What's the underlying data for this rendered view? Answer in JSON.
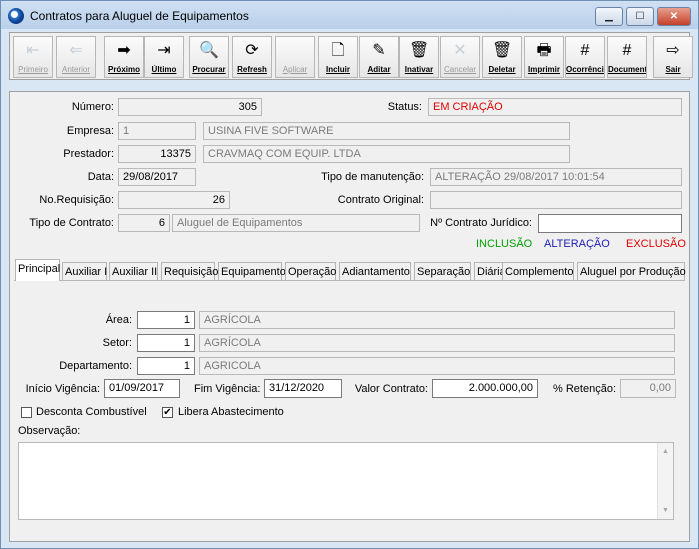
{
  "window": {
    "title": "Contratos para Aluguel de Equipamentos",
    "controls": {
      "minimize": "▁",
      "maximize": "☐",
      "close": "✕"
    }
  },
  "toolbar": [
    {
      "id": "primeiro",
      "label": "Primeiro",
      "icon": "first-record-icon",
      "glyph": "⇤",
      "enabled": false
    },
    {
      "id": "anterior",
      "label": "Anterior",
      "icon": "previous-record-icon",
      "glyph": "⇐",
      "enabled": false
    },
    {
      "id": "proximo",
      "label": "Próximo",
      "icon": "next-record-icon",
      "glyph": "➡",
      "enabled": true
    },
    {
      "id": "ultimo",
      "label": "Último",
      "icon": "last-record-icon",
      "glyph": "⇥",
      "enabled": true
    },
    {
      "id": "procurar",
      "label": "Procurar",
      "icon": "search-icon",
      "glyph": "🔍",
      "enabled": true
    },
    {
      "id": "refresh",
      "label": "Refresh",
      "icon": "refresh-icon",
      "glyph": "⟳",
      "enabled": true
    },
    {
      "id": "aplicar",
      "label": "Aplicar",
      "icon": "apply-icon",
      "glyph": "",
      "enabled": false
    },
    {
      "id": "incluir",
      "label": "Incluir",
      "icon": "new-document-icon",
      "glyph": "🗋",
      "enabled": true
    },
    {
      "id": "aditar",
      "label": "Aditar",
      "icon": "edit-eraser-icon",
      "glyph": "✎",
      "enabled": true
    },
    {
      "id": "inativar",
      "label": "Inativar",
      "icon": "trash-bin-icon",
      "glyph": "🗑",
      "enabled": true
    },
    {
      "id": "cancelar",
      "label": "Cancelar",
      "icon": "cancel-icon",
      "glyph": "✕",
      "enabled": false
    },
    {
      "id": "deletar",
      "label": "Deletar",
      "icon": "delete-bin-icon",
      "glyph": "🗑",
      "enabled": true
    },
    {
      "id": "imprimir",
      "label": "Imprimir",
      "icon": "printer-icon",
      "glyph": "🖶",
      "enabled": true
    },
    {
      "id": "ocorrencia",
      "label": "Ocorrência",
      "icon": "grid-icon",
      "glyph": "#",
      "enabled": true
    },
    {
      "id": "documento",
      "label": "Documento",
      "icon": "grid-document-icon",
      "glyph": "#",
      "enabled": true
    },
    {
      "id": "sair",
      "label": "Sair",
      "icon": "exit-door-icon",
      "glyph": "⇨",
      "enabled": true
    }
  ],
  "form": {
    "numero": {
      "label": "Número:",
      "value": "305"
    },
    "status": {
      "label": "Status:",
      "value": "EM CRIAÇÃO"
    },
    "empresa": {
      "label": "Empresa:",
      "code": "1",
      "name": "USINA FIVE SOFTWARE"
    },
    "prestador": {
      "label": "Prestador:",
      "code": "13375",
      "name": "CRAVMAQ COM EQUIP. LTDA"
    },
    "data": {
      "label": "Data:",
      "value": "29/08/2017"
    },
    "tipo_manutencao": {
      "label": "Tipo de manutenção:",
      "value": "ALTERAÇÃO 29/08/2017 10:01:54"
    },
    "no_requisicao": {
      "label": "No.Requisição:",
      "value": "26"
    },
    "contrato_original": {
      "label": "Contrato Original:",
      "value": ""
    },
    "tipo_contrato": {
      "label": "Tipo de Contrato:",
      "code": "6",
      "name": "Aluguel de Equipamentos"
    },
    "contrato_juridico": {
      "label": "Nº Contrato Jurídico:",
      "value": ""
    },
    "flags": {
      "inclusao": "INCLUSÃO",
      "alteracao": "ALTERAÇÃO",
      "exclusao": "EXCLUSÃO",
      "colors": {
        "inclusao": "#00a000",
        "alteracao": "#1c1cb4",
        "exclusao": "#e00000"
      }
    }
  },
  "tabs": [
    {
      "label": "Principal",
      "active": true
    },
    {
      "label": "Auxiliar I",
      "active": false
    },
    {
      "label": "Auxiliar II",
      "active": false
    },
    {
      "label": "Requisição",
      "active": false
    },
    {
      "label": "Equipamento",
      "active": false
    },
    {
      "label": "Operação",
      "active": false
    },
    {
      "label": "Adiantamento",
      "active": false
    },
    {
      "label": "Separação",
      "active": false
    },
    {
      "label": "Diária",
      "active": false
    },
    {
      "label": "Complemento",
      "active": false
    },
    {
      "label": "Aluguel por Produção",
      "active": false
    }
  ],
  "principal": {
    "area": {
      "label": "Área:",
      "code": "1",
      "name": "AGRÍCOLA"
    },
    "setor": {
      "label": "Setor:",
      "code": "1",
      "name": "AGRÍCOLA"
    },
    "departamento": {
      "label": "Departamento:",
      "code": "1",
      "name": "AGRICOLA"
    },
    "inicio_vigencia": {
      "label": "Início Vigência:",
      "value": "01/09/2017"
    },
    "fim_vigencia": {
      "label": "Fim Vigência:",
      "value": "31/12/2020"
    },
    "valor_contrato": {
      "label": "Valor Contrato:",
      "value": "2.000.000,00"
    },
    "retencao": {
      "label": "% Retenção:",
      "value": "0,00"
    },
    "desconta_combustivel": {
      "label": "Desconta Combustível",
      "checked": false
    },
    "libera_abastecimento": {
      "label": "Libera Abastecimento",
      "checked": true
    },
    "observacao": {
      "label": "Observação:",
      "value": ""
    }
  },
  "scrollbar": {
    "up": "▲",
    "down": "▼"
  }
}
